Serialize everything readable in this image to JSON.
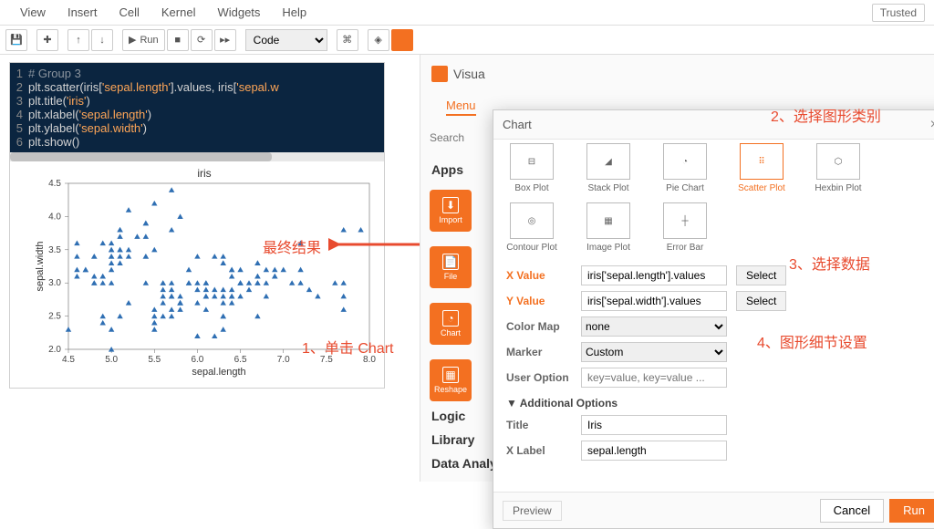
{
  "menubar": {
    "items": [
      "View",
      "Insert",
      "Cell",
      "Kernel",
      "Widgets",
      "Help"
    ],
    "trusted": "Trusted"
  },
  "toolbar": {
    "run": "Run",
    "celltype": "Code"
  },
  "code": {
    "lines": [
      {
        "n": "1",
        "pre": "",
        "comment": "# Group 3"
      },
      {
        "n": "2",
        "pre": "plt.scatter(iris[",
        "s1": "'sepal.length'",
        "mid": "].values, iris[",
        "s2": "'sepal.w"
      },
      {
        "n": "3",
        "pre": "plt.title(",
        "s1": "'iris'",
        "post": ")"
      },
      {
        "n": "4",
        "pre": "plt.xlabel(",
        "s1": "'sepal.length'",
        "post": ")"
      },
      {
        "n": "5",
        "pre": "plt.ylabel(",
        "s1": "'sepal.width'",
        "post": ")"
      },
      {
        "n": "6",
        "pre": "plt.show()",
        "s1": "",
        "post": ""
      }
    ]
  },
  "chart_data": {
    "type": "scatter",
    "title": "iris",
    "xlabel": "sepal.length",
    "ylabel": "sepal.width",
    "xlim": [
      4.5,
      8.0
    ],
    "ylim": [
      2.0,
      4.5
    ],
    "xticks": [
      4.5,
      5.0,
      5.5,
      6.0,
      6.5,
      7.0,
      7.5,
      8.0
    ],
    "yticks": [
      2.0,
      2.5,
      3.0,
      3.5,
      4.0,
      4.5
    ],
    "points": [
      [
        5.1,
        3.5
      ],
      [
        4.9,
        3.0
      ],
      [
        4.7,
        3.2
      ],
      [
        4.6,
        3.1
      ],
      [
        5.0,
        3.6
      ],
      [
        5.4,
        3.9
      ],
      [
        4.6,
        3.4
      ],
      [
        5.0,
        3.4
      ],
      [
        4.4,
        2.9
      ],
      [
        4.9,
        3.1
      ],
      [
        5.4,
        3.7
      ],
      [
        4.8,
        3.4
      ],
      [
        4.8,
        3.0
      ],
      [
        4.3,
        3.0
      ],
      [
        5.8,
        4.0
      ],
      [
        5.7,
        4.4
      ],
      [
        5.4,
        3.9
      ],
      [
        5.1,
        3.5
      ],
      [
        5.7,
        3.8
      ],
      [
        5.1,
        3.8
      ],
      [
        5.4,
        3.4
      ],
      [
        5.1,
        3.7
      ],
      [
        4.6,
        3.6
      ],
      [
        5.1,
        3.3
      ],
      [
        4.8,
        3.4
      ],
      [
        5.0,
        3.0
      ],
      [
        5.0,
        3.4
      ],
      [
        5.2,
        3.5
      ],
      [
        5.2,
        3.4
      ],
      [
        4.7,
        3.2
      ],
      [
        4.8,
        3.1
      ],
      [
        5.4,
        3.4
      ],
      [
        5.2,
        4.1
      ],
      [
        5.5,
        4.2
      ],
      [
        4.9,
        3.1
      ],
      [
        5.0,
        3.2
      ],
      [
        5.5,
        3.5
      ],
      [
        4.9,
        3.6
      ],
      [
        4.4,
        3.0
      ],
      [
        5.1,
        3.4
      ],
      [
        5.0,
        3.5
      ],
      [
        4.5,
        2.3
      ],
      [
        4.4,
        3.2
      ],
      [
        5.0,
        3.5
      ],
      [
        5.1,
        3.8
      ],
      [
        4.8,
        3.0
      ],
      [
        5.1,
        3.8
      ],
      [
        4.6,
        3.2
      ],
      [
        5.3,
        3.7
      ],
      [
        5.0,
        3.3
      ],
      [
        7.0,
        3.2
      ],
      [
        6.4,
        3.2
      ],
      [
        6.9,
        3.1
      ],
      [
        5.5,
        2.3
      ],
      [
        6.5,
        2.8
      ],
      [
        5.7,
        2.8
      ],
      [
        6.3,
        3.3
      ],
      [
        4.9,
        2.4
      ],
      [
        6.6,
        2.9
      ],
      [
        5.2,
        2.7
      ],
      [
        5.0,
        2.0
      ],
      [
        5.9,
        3.0
      ],
      [
        6.0,
        2.2
      ],
      [
        6.1,
        2.9
      ],
      [
        5.6,
        2.9
      ],
      [
        6.7,
        3.1
      ],
      [
        5.6,
        3.0
      ],
      [
        5.8,
        2.7
      ],
      [
        6.2,
        2.2
      ],
      [
        5.6,
        2.5
      ],
      [
        5.9,
        3.2
      ],
      [
        6.1,
        2.8
      ],
      [
        6.3,
        2.5
      ],
      [
        6.1,
        2.8
      ],
      [
        6.4,
        2.9
      ],
      [
        6.6,
        3.0
      ],
      [
        6.8,
        2.8
      ],
      [
        6.7,
        3.0
      ],
      [
        6.0,
        2.9
      ],
      [
        5.7,
        2.6
      ],
      [
        5.5,
        2.4
      ],
      [
        5.5,
        2.4
      ],
      [
        5.8,
        2.7
      ],
      [
        6.0,
        2.7
      ],
      [
        5.4,
        3.0
      ],
      [
        6.0,
        3.4
      ],
      [
        6.7,
        3.1
      ],
      [
        6.3,
        2.3
      ],
      [
        5.6,
        3.0
      ],
      [
        5.5,
        2.5
      ],
      [
        5.5,
        2.6
      ],
      [
        6.1,
        3.0
      ],
      [
        5.8,
        2.6
      ],
      [
        5.0,
        2.3
      ],
      [
        5.6,
        2.7
      ],
      [
        5.7,
        3.0
      ],
      [
        5.7,
        2.9
      ],
      [
        6.2,
        2.9
      ],
      [
        5.1,
        2.5
      ],
      [
        5.7,
        2.8
      ],
      [
        6.3,
        3.3
      ],
      [
        5.8,
        2.7
      ],
      [
        7.1,
        3.0
      ],
      [
        6.3,
        2.9
      ],
      [
        6.5,
        3.0
      ],
      [
        7.6,
        3.0
      ],
      [
        4.9,
        2.5
      ],
      [
        7.3,
        2.9
      ],
      [
        6.7,
        2.5
      ],
      [
        7.2,
        3.6
      ],
      [
        6.5,
        3.2
      ],
      [
        6.4,
        2.7
      ],
      [
        6.8,
        3.0
      ],
      [
        5.7,
        2.5
      ],
      [
        5.8,
        2.8
      ],
      [
        6.4,
        3.2
      ],
      [
        6.5,
        3.0
      ],
      [
        7.7,
        3.8
      ],
      [
        7.7,
        2.6
      ],
      [
        6.0,
        2.2
      ],
      [
        6.9,
        3.2
      ],
      [
        5.6,
        2.8
      ],
      [
        7.7,
        2.8
      ],
      [
        6.3,
        2.7
      ],
      [
        6.7,
        3.3
      ],
      [
        7.2,
        3.2
      ],
      [
        6.2,
        2.8
      ],
      [
        6.1,
        3.0
      ],
      [
        6.4,
        2.8
      ],
      [
        7.2,
        3.0
      ],
      [
        7.4,
        2.8
      ],
      [
        7.9,
        3.8
      ],
      [
        6.4,
        2.8
      ],
      [
        6.3,
        2.8
      ],
      [
        6.1,
        2.6
      ],
      [
        7.7,
        3.0
      ],
      [
        6.3,
        3.4
      ],
      [
        6.4,
        3.1
      ],
      [
        6.0,
        3.0
      ],
      [
        6.9,
        3.1
      ],
      [
        6.7,
        3.1
      ],
      [
        6.9,
        3.1
      ],
      [
        5.8,
        2.7
      ],
      [
        6.8,
        3.2
      ],
      [
        6.7,
        3.3
      ],
      [
        6.7,
        3.0
      ],
      [
        6.3,
        2.5
      ],
      [
        6.5,
        3.0
      ],
      [
        6.2,
        3.4
      ],
      [
        5.9,
        3.0
      ]
    ]
  },
  "anno": {
    "result": "最终结果",
    "a1": "1、单击 Chart",
    "a2": "2、选择图形类别",
    "a3": "3、选择数据",
    "a4": "4、图形细节设置"
  },
  "side": {
    "logo": "Visua",
    "menu": "Menu",
    "search": "Search",
    "apps": "Apps",
    "tiles": [
      "Import",
      "File",
      "Chart",
      "Reshape"
    ],
    "cats": [
      "Logic",
      "Library",
      "Data Analy"
    ]
  },
  "dialog": {
    "title": "Chart",
    "types": [
      "Box Plot",
      "Stack Plot",
      "Pie Chart",
      "Scatter Plot",
      "Hexbin Plot",
      "Contour Plot",
      "Image Plot",
      "Error Bar"
    ],
    "selected": "Scatter Plot",
    "xlabel": "X Value",
    "ylabel": "Y Value",
    "select": "Select",
    "xval": "iris['sepal.length'].values",
    "yval": "iris['sepal.width'].values",
    "cmap_l": "Color Map",
    "cmap": "none",
    "marker_l": "Marker",
    "marker": "Custom",
    "uopt_l": "User Option",
    "uopt_ph": "key=value, key=value ...",
    "addl": "Additional Options",
    "title_l": "Title",
    "title_v": "Iris",
    "xl_l": "X Label",
    "xl_v": "sepal.length",
    "preview": "Preview",
    "cancel": "Cancel",
    "run": "Run"
  }
}
